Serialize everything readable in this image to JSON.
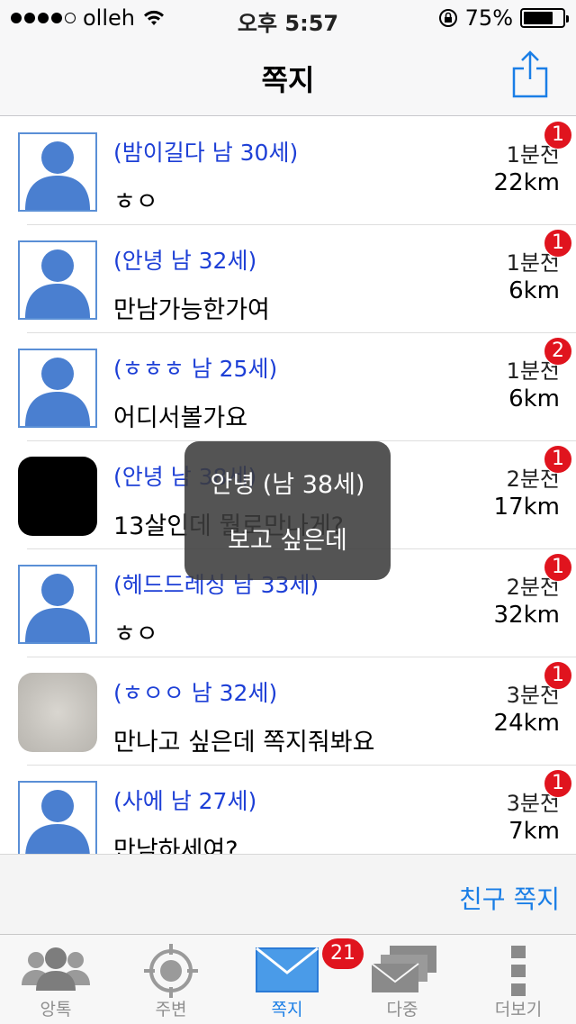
{
  "status": {
    "carrier": "olleh",
    "time": "오후 5:57",
    "battery": "75%",
    "battery_level": 0.75
  },
  "nav": {
    "title": "쪽지",
    "share_icon": "share-icon"
  },
  "messages": [
    {
      "name": "(밤이길다 남 30세)",
      "text": "ㅎㅇ",
      "time": "1분전",
      "distance": "22km",
      "badge": "1",
      "avatar": "silhouette"
    },
    {
      "name": "(안녕 남 32세)",
      "text": "만남가능한가여",
      "time": "1분전",
      "distance": "6km",
      "badge": "1",
      "avatar": "silhouette"
    },
    {
      "name": "(ㅎㅎㅎ 남 25세)",
      "text": "어디서볼가요",
      "time": "1분전",
      "distance": "6km",
      "badge": "2",
      "avatar": "silhouette"
    },
    {
      "name": "(안녕 남 38세)",
      "text": "13살인데  뭘로만나게?",
      "time": "2분전",
      "distance": "17km",
      "badge": "1",
      "avatar": "black"
    },
    {
      "name": "(헤드드레싱 남 33세)",
      "text": "ㅎㅇ",
      "time": "2분전",
      "distance": "32km",
      "badge": "1",
      "avatar": "silhouette"
    },
    {
      "name": "(ㅎㅇㅇ 남 32세)",
      "text": "만나고 싶은데 쪽지줘봐요",
      "time": "3분전",
      "distance": "24km",
      "badge": "1",
      "avatar": "blur"
    },
    {
      "name": "(사에 남 27세)",
      "text": "만남하세여?",
      "time": "3분전",
      "distance": "7km",
      "badge": "1",
      "avatar": "silhouette"
    }
  ],
  "toast": {
    "line1": "안녕 (남 38세)",
    "line2": "보고 싶은데"
  },
  "friend_button": "친구 쪽지",
  "tabs": [
    {
      "label": "앙톡",
      "icon": "people-icon",
      "active": false
    },
    {
      "label": "주변",
      "icon": "target-icon",
      "active": false
    },
    {
      "label": "쪽지",
      "icon": "envelope-icon",
      "active": true
    },
    {
      "label": "다중",
      "icon": "multi-envelope-icon",
      "active": false
    },
    {
      "label": "더보기",
      "icon": "more-icon",
      "active": false
    }
  ],
  "tab_badge": "21",
  "colors": {
    "accent": "#1a7ee6",
    "name_blue": "#1d3fd6",
    "badge_red": "#e0141e",
    "avatar_blue": "#4a7fd0"
  }
}
